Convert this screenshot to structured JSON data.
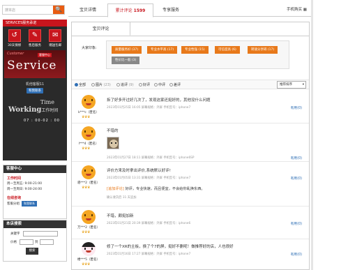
{
  "sidebar": {
    "search_placeholder": "搜本店",
    "search_icon": "🔍",
    "service": {
      "title": "SERVICES服务承诺",
      "icons": [
        {
          "label": "30天保修",
          "glyph": "↺"
        },
        {
          "label": "售后服务",
          "glyph": "✎"
        },
        {
          "label": "赠送包邮",
          "glyph": "✉"
        }
      ],
      "banner_cs": "Customer",
      "banner_tag": "客服中心",
      "banner_big": "Service",
      "agent_name": "机他客服11",
      "agent_btn": "和我联系",
      "time_word": "Time",
      "working_word": "Working",
      "working_sub": "工作时间",
      "hours": "07 : 00-02 : 00"
    },
    "cs_panel": {
      "title": "客服中心",
      "work_label": "工作时间",
      "line1": "周一至周五: 9:00-21:00",
      "line2": "周一至周日: 9:00-24:00",
      "online_label": "在线咨询",
      "online_line": "客服分组",
      "online_btn": "和我联系"
    },
    "shop_search": {
      "title": "本店搜索",
      "keyword_label": "关键字",
      "price_label": "价格",
      "price_sep": "到",
      "button": "搜索"
    }
  },
  "topnav": {
    "tabs": [
      "宝贝详情",
      "累计评论",
      "专享服务"
    ],
    "review_count": "1599",
    "seller_link": "手机购买"
  },
  "review": {
    "subtab": "宝贝评论",
    "impression_label": "大家印象:",
    "tags": [
      "质量服务好 (37)",
      "专业水平高 (17)",
      "专业性强 (15)",
      "可信度高 (6)",
      "转速分享碎 (17)",
      "性价比一般 (3)"
    ],
    "filters": [
      {
        "label": "全部",
        "count": ""
      },
      {
        "label": "图片",
        "count": "(23)"
      },
      {
        "label": "追评",
        "count": "(9)"
      },
      {
        "label": "好评",
        "count": ""
      },
      {
        "label": "中评",
        "count": ""
      },
      {
        "label": "差评",
        "count": ""
      }
    ],
    "sort_label": "推荐排序",
    "useful_label": "有用",
    "useful_count": "(0)",
    "items": [
      {
        "text": "拆了好多开过好几次了，发现这家还挺好的，其他没什么问题",
        "user": "k***c（匿名）",
        "meta": "2023年01月25日 16:05  屏幕规格：外屏  手机型号：iphone7",
        "crowns": "♛♛♛"
      },
      {
        "text": "不错的",
        "user": "l***4（匿名）",
        "meta": "2023年01月27日 18:11  屏幕规格：外屏  手机型号：iphone6SP",
        "crowns": "♛♛♛"
      },
      {
        "text": "评价方来及时拿出评价,系统默认好评!",
        "user": "骆***2（匿名）",
        "meta": "2023年01月05日 13:31  屏幕规格：外屏  手机型号：iphone7",
        "crowns": "♛♛♛",
        "add_label": "[追加评论]",
        "add_text": " 好评，专业快速，而且便宜，不会给你乱换东西。",
        "add_meta": "确认收货后 31 天追加"
      },
      {
        "text": "不错，颇挺加新",
        "user": "万***2（匿名）",
        "meta": "2023年01月21日 20:39  屏幕规格：外屏  手机型号：iphone6",
        "crowns": "♛♛♛"
      },
      {
        "text": "修了一个XR的主板，换了个7的屏，挺好不删呢！做推荐好的店，人也很好",
        "user": "楼***5（匿名）",
        "meta": "2023年01月16日 17:27  屏幕规格：外屏  手机型号：iphone7",
        "crowns": "♛♛♛"
      }
    ]
  },
  "colors": {
    "brand_red": "#c8151d",
    "accent_orange": "#e8791a",
    "link_blue": "#2f6fb5"
  }
}
